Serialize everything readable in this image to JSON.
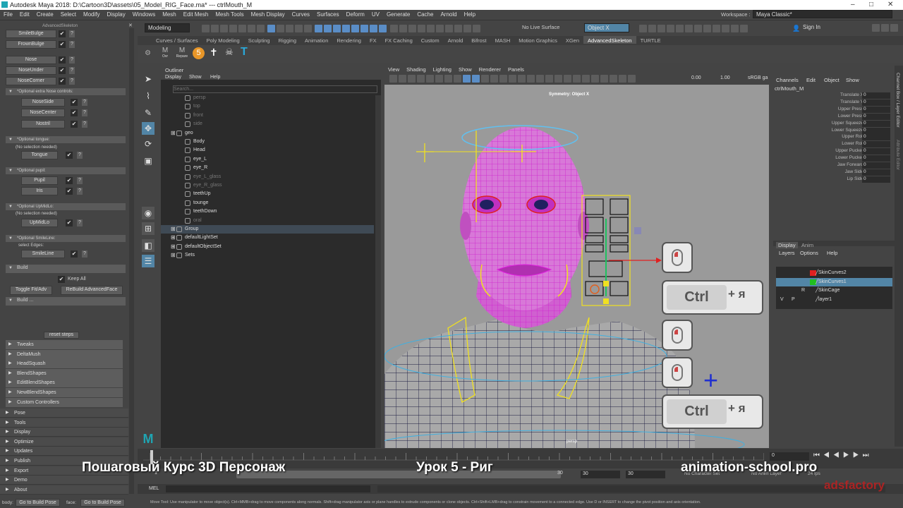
{
  "window": {
    "title": "Autodesk Maya 2018: D:\\Cartoon3D\\assets\\05_Model_RIG_Face.ma*   ---   ctrlMouth_M",
    "controls": [
      "–",
      "□",
      "✕"
    ]
  },
  "menubar": [
    "File",
    "Edit",
    "Create",
    "Select",
    "Modify",
    "Display",
    "Windows",
    "Mesh",
    "Edit Mesh",
    "Mesh Tools",
    "Mesh Display",
    "Curves",
    "Surfaces",
    "Deform",
    "UV",
    "Generate",
    "Cache",
    "Arnold",
    "Help"
  ],
  "workspace": {
    "label": "Workspace :",
    "value": "Maya Classic*"
  },
  "toolbar": {
    "mode": "Modeling",
    "live_surface": "No Live Surface",
    "symmetry": "Object X",
    "sign_in": "Sign In"
  },
  "shelf_tabs": [
    "Curves / Surfaces",
    "Poly Modeling",
    "Sculpting",
    "Rigging",
    "Animation",
    "Rendering",
    "FX",
    "FX Caching",
    "Custom",
    "Arnold",
    "Bifrost",
    "MASH",
    "Motion Graphics",
    "XGen",
    "AdvancedSkeleton",
    "TURTLE"
  ],
  "shelf_active": "AdvancedSkeleton",
  "shelf_icons": [
    "Ovr",
    "Repare"
  ],
  "left_panel": {
    "header": "AdvancedSkeleton",
    "top_buttons": [
      "SmileBulge",
      "FrownBulge"
    ],
    "nose_buttons": [
      "Nose",
      "NoseUnder",
      "NoseCorner"
    ],
    "optional_nose": "*Optional extra Nose controls:",
    "nose_extra": [
      "NoseSide",
      "NoseCenter",
      "Nostril"
    ],
    "optional_tongue": "*Optional tongue:",
    "no_selection": "(No selection needed)",
    "tongue": "Tongue",
    "optional_pupil": "*Optional pupil:",
    "pupil": [
      "Pupil",
      "Iris"
    ],
    "optional_upmidlo": "*Optional UpMidLo:",
    "upmidlo": "UpMidLo",
    "optional_smileline": "*Optional SmileLine:",
    "select_edges": "select Edges:",
    "smileline": "SmileLine",
    "build": "Build",
    "keep_all": "Keep All",
    "toggle_fit": "Toggle Fit/Adv",
    "rebuild": "ReBuild AdvancedFace",
    "build_more": "Build ...",
    "reset_steps": "reset steps",
    "subsections": [
      "Tweaks",
      "DeltaMush",
      "HeadSquash",
      "BlendShapes",
      "EditBlendShapes",
      "NewBlendShapes",
      "Custom Controllers"
    ],
    "sections": [
      "Pose",
      "Tools",
      "Display",
      "Optimize",
      "Updates",
      "Publish",
      "Export",
      "Demo",
      "About"
    ]
  },
  "outliner": {
    "title": "Outliner",
    "menu": [
      "Display",
      "Show",
      "Help"
    ],
    "search": "Search...",
    "items": [
      {
        "label": "persp",
        "dim": true,
        "indent": 1
      },
      {
        "label": "top",
        "dim": true,
        "indent": 1
      },
      {
        "label": "front",
        "dim": true,
        "indent": 1
      },
      {
        "label": "side",
        "dim": true,
        "indent": 1
      },
      {
        "label": "geo",
        "dim": false,
        "indent": 0
      },
      {
        "label": "Body",
        "dim": false,
        "indent": 1
      },
      {
        "label": "Head",
        "dim": false,
        "indent": 1
      },
      {
        "label": "eye_L",
        "dim": false,
        "indent": 1
      },
      {
        "label": "eye_R",
        "dim": false,
        "indent": 1
      },
      {
        "label": "eye_L_glass",
        "dim": true,
        "indent": 1
      },
      {
        "label": "eye_R_glass",
        "dim": true,
        "indent": 1
      },
      {
        "label": "teethUp",
        "dim": false,
        "indent": 1
      },
      {
        "label": "tounge",
        "dim": false,
        "indent": 1
      },
      {
        "label": "teethDown",
        "dim": false,
        "indent": 1
      },
      {
        "label": "oral",
        "dim": true,
        "indent": 1
      },
      {
        "label": "Group",
        "dim": false,
        "indent": 0
      },
      {
        "label": "defaultLightSet",
        "dim": false,
        "indent": 0
      },
      {
        "label": "defaultObjectSet",
        "dim": false,
        "indent": 0
      },
      {
        "label": "Sets",
        "dim": false,
        "indent": 0
      }
    ]
  },
  "viewport": {
    "menu": [
      "View",
      "Shading",
      "Lighting",
      "Show",
      "Renderer",
      "Panels"
    ],
    "symmetry_label": "Symmetry: Object X",
    "camera": "persp",
    "value_a": "0.00",
    "value_b": "1.00",
    "colorspace": "sRGB ga"
  },
  "keyhints": {
    "ctrl": "Ctrl",
    "plus": "+",
    "ya": "я"
  },
  "channel_box": {
    "menu": [
      "Channels",
      "Edit",
      "Object",
      "Show"
    ],
    "object": "ctrlMouth_M",
    "attrs": [
      {
        "n": "Translate X",
        "v": "0"
      },
      {
        "n": "Translate Y",
        "v": "0"
      },
      {
        "n": "Upper Press",
        "v": "0"
      },
      {
        "n": "Lower Press",
        "v": "0"
      },
      {
        "n": "Upper Squeeze",
        "v": "0"
      },
      {
        "n": "Lower Squeeze",
        "v": "0"
      },
      {
        "n": "Upper Roll",
        "v": "0"
      },
      {
        "n": "Lower Roll",
        "v": "0"
      },
      {
        "n": "Upper Pucker",
        "v": "0"
      },
      {
        "n": "Lower Pucker",
        "v": "0"
      },
      {
        "n": "Jaw Forward",
        "v": "0"
      },
      {
        "n": "Jaw Side",
        "v": "0"
      },
      {
        "n": "Lip Side",
        "v": "0"
      }
    ],
    "side_tabs": [
      "Channel Box / Layer Editor",
      "Attribute Editor"
    ]
  },
  "layer_editor": {
    "tabs": [
      "Display",
      "Anim"
    ],
    "menu": [
      "Layers",
      "Options",
      "Help"
    ],
    "layers": [
      {
        "name": "SkinCurves2",
        "color": "#e02020",
        "v": "",
        "p": "",
        "r": "",
        "sel": false
      },
      {
        "name": "SkinCurves1",
        "color": "#20c020",
        "v": "",
        "p": "",
        "r": "",
        "sel": true
      },
      {
        "name": "SkinCage",
        "color": "",
        "v": "",
        "p": "",
        "r": "R",
        "sel": false
      },
      {
        "name": "layer1",
        "color": "",
        "v": "V",
        "p": "P",
        "r": "",
        "sel": false
      }
    ]
  },
  "timeline": {
    "start": "1",
    "current": "0",
    "range_start": "30",
    "range_end": "30",
    "range_mid": "30",
    "no_char_set": "No Character Set",
    "no_anim_layer": "No Anim Layer",
    "fps": "24 fps"
  },
  "command_line": {
    "label": "MEL"
  },
  "help_line": {
    "text": "Move Tool: Use manipulator to move object(s). Ctrl+MMB+drag to move components along normals. Shift+drag manipulator axis or plane handles to extrude components or clone objects. Ctrl+Shift+LMB+drag to constrain movement to a connected edge. Use D or INSERT to change the pivot position and axis orientation.",
    "left_label": "body:",
    "go_build_pose_1": "Go to Build Pose",
    "face_label": "face:",
    "go_build_pose_2": "Go to Build Pose"
  },
  "watermark": {
    "left": "Пошаговый Курс 3D Персонаж",
    "middle": "Урок 5 - Риг",
    "right": "animation-school.pro",
    "brand": "adsfactory"
  }
}
